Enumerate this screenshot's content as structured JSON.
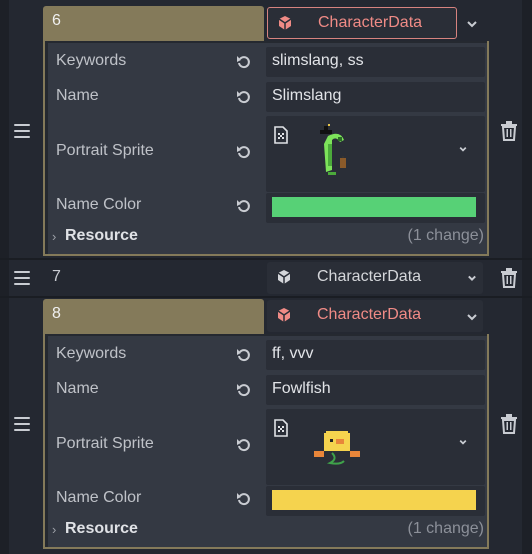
{
  "colors": {
    "header_bg": "#847a5a",
    "accent_text": "#f08b86",
    "slimslang_color": "#57d176",
    "fowlfish_color": "#f5d34e"
  },
  "entries": [
    {
      "index": "6",
      "type": "CharacterData",
      "keywords_label": "Keywords",
      "keywords_value": "slimslang, ss",
      "name_label": "Name",
      "name_value": "Slimslang",
      "portrait_label": "Portrait Sprite",
      "name_color_label": "Name Color",
      "resource_label": "Resource",
      "resource_changes": "(1 change)"
    },
    {
      "index": "7",
      "type": "CharacterData"
    },
    {
      "index": "8",
      "type": "CharacterData",
      "keywords_label": "Keywords",
      "keywords_value": "ff, vvv",
      "name_label": "Name",
      "name_value": "Fowlfish",
      "portrait_label": "Portrait Sprite",
      "name_color_label": "Name Color",
      "resource_label": "Resource",
      "resource_changes": "(1 change)"
    }
  ],
  "icons": {
    "handle": "drag-handle-icon",
    "delete": "trash-icon",
    "resource_type": "cube-icon",
    "dropdown": "chevron-down-icon",
    "revert": "revert-icon",
    "texture": "texture-icon"
  }
}
